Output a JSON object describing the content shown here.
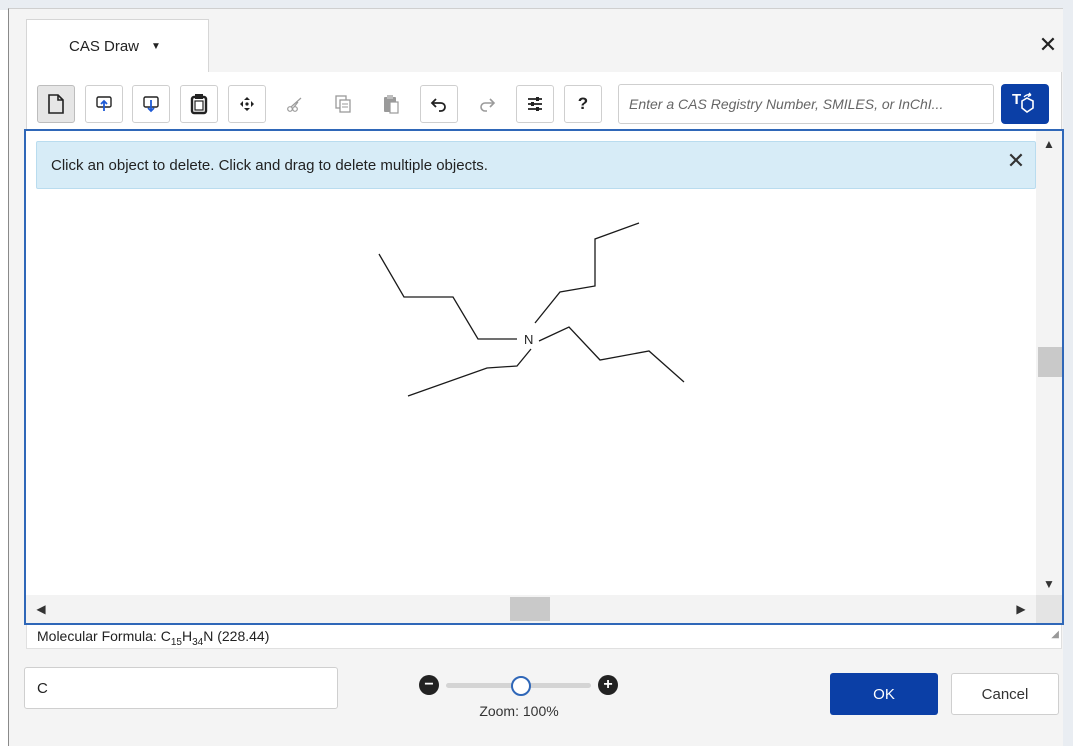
{
  "header": {
    "tab_label": "CAS Draw",
    "close_symbol": "✕"
  },
  "toolbar": {
    "tools": [
      {
        "name": "new-document-icon",
        "state": "active"
      },
      {
        "name": "import-icon",
        "state": "enabled"
      },
      {
        "name": "export-icon",
        "state": "enabled"
      },
      {
        "name": "templates-icon",
        "state": "enabled"
      },
      {
        "name": "recenter-icon",
        "state": "enabled"
      },
      {
        "name": "cut-icon",
        "state": "disabled"
      },
      {
        "name": "copy-icon",
        "state": "disabled"
      },
      {
        "name": "paste-icon",
        "state": "disabled"
      },
      {
        "name": "undo-icon",
        "state": "enabled"
      },
      {
        "name": "redo-icon",
        "state": "disabled"
      },
      {
        "name": "settings-icon",
        "state": "enabled"
      },
      {
        "name": "help-icon",
        "state": "enabled"
      }
    ],
    "help_label": "?",
    "search_placeholder": "Enter a CAS Registry Number, SMILES, or InChI...",
    "search_display": "Enter a CAS Registry Number, SMILES, or InChI...",
    "text_to_structure_letter": "T"
  },
  "canvas": {
    "info_message": "Click an object to delete. Click and drag to delete multiple objects.",
    "nitrogen_label": "N"
  },
  "formula": {
    "prefix": "Molecular Formula: ",
    "c": "C",
    "c_sub": "15",
    "h": "H",
    "h_sub": "34",
    "n": "N",
    "weight": "(228.44)"
  },
  "footer": {
    "atom_input_value": "C",
    "zoom_label": "Zoom: 100%",
    "zoom_level_percent": 100,
    "ok_label": "OK",
    "cancel_label": "Cancel"
  },
  "colors": {
    "accent": "#0b3fa6",
    "canvas_border": "#2f67b8",
    "info_bg": "#d7ecf7"
  }
}
